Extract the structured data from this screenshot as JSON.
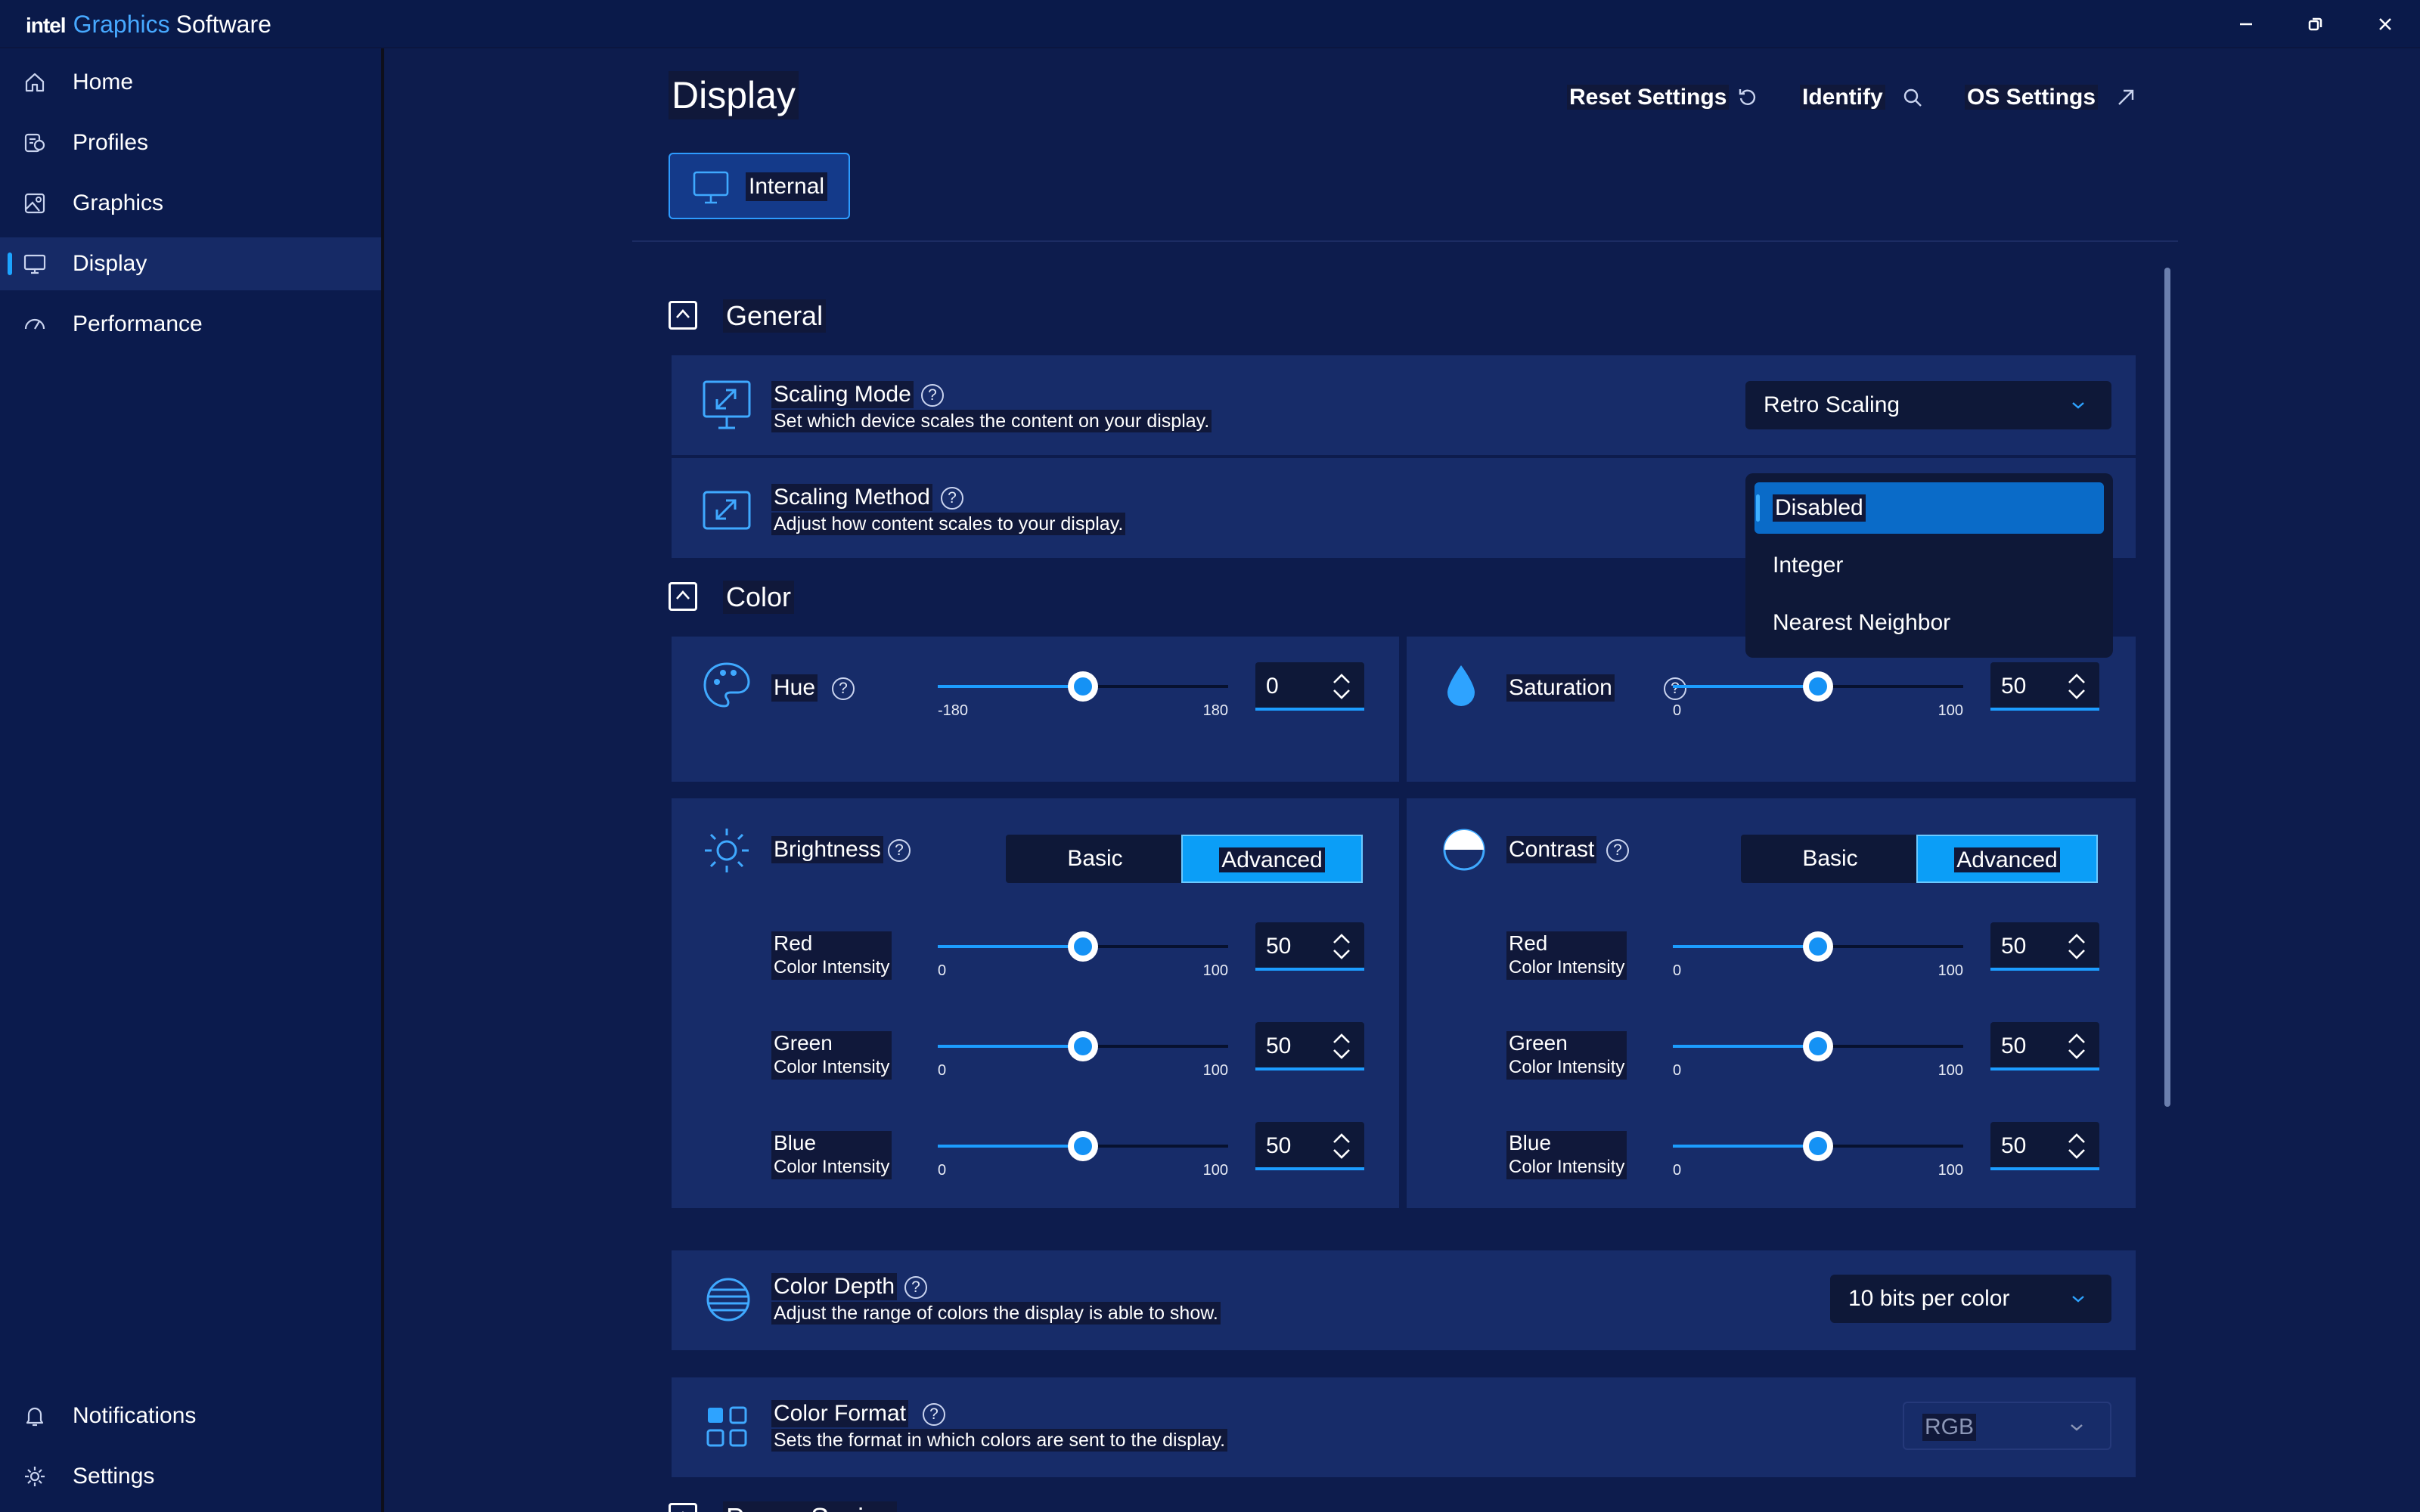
{
  "app": {
    "brand_intel": "intel",
    "brand_graphics": "Graphics",
    "brand_software": "Software",
    "accent_color": "#1c9dff"
  },
  "window_controls": [
    "minimize-icon",
    "restore-icon",
    "close-icon"
  ],
  "sidebar": {
    "items": [
      {
        "label": "Home",
        "icon": "home-icon"
      },
      {
        "label": "Profiles",
        "icon": "profiles-icon"
      },
      {
        "label": "Graphics",
        "icon": "graphics-icon"
      },
      {
        "label": "Display",
        "icon": "display-icon",
        "active": true
      },
      {
        "label": "Performance",
        "icon": "performance-icon"
      }
    ],
    "bottom_items": [
      {
        "label": "Notifications",
        "icon": "bell-icon"
      },
      {
        "label": "Settings",
        "icon": "gear-icon"
      }
    ]
  },
  "header": {
    "title": "Display",
    "reset_label": "Reset Settings",
    "identify_label": "Identify",
    "os_settings_label": "OS Settings",
    "display_tab": "Internal"
  },
  "general": {
    "title": "General",
    "scaling_mode": {
      "title": "Scaling Mode",
      "desc": "Set which device scales the content on your display.",
      "value": "Retro Scaling"
    },
    "scaling_method": {
      "title": "Scaling Method",
      "desc": "Adjust how content scales to your display.",
      "options": [
        "Disabled",
        "Integer",
        "Nearest Neighbor"
      ],
      "selected": "Disabled"
    }
  },
  "color": {
    "title": "Color",
    "hue": {
      "label": "Hue",
      "min": "-180",
      "max": "180",
      "value": "0",
      "min_num": -180,
      "max_num": 180,
      "num": 0
    },
    "saturation": {
      "label": "Saturation",
      "min": "0",
      "max": "100",
      "value": "50",
      "min_num": 0,
      "max_num": 100,
      "num": 50
    },
    "brightness": {
      "label": "Brightness",
      "basic": "Basic",
      "advanced": "Advanced",
      "mode": "Advanced",
      "channels": [
        {
          "name": "Red",
          "sub": "Color Intensity",
          "min": "0",
          "max": "100",
          "value": "50",
          "num": 50
        },
        {
          "name": "Green",
          "sub": "Color Intensity",
          "min": "0",
          "max": "100",
          "value": "50",
          "num": 50
        },
        {
          "name": "Blue",
          "sub": "Color Intensity",
          "min": "0",
          "max": "100",
          "value": "50",
          "num": 50
        }
      ]
    },
    "contrast": {
      "label": "Contrast",
      "basic": "Basic",
      "advanced": "Advanced",
      "mode": "Advanced",
      "channels": [
        {
          "name": "Red",
          "sub": "Color Intensity",
          "min": "0",
          "max": "100",
          "value": "50",
          "num": 50
        },
        {
          "name": "Green",
          "sub": "Color Intensity",
          "min": "0",
          "max": "100",
          "value": "50",
          "num": 50
        },
        {
          "name": "Blue",
          "sub": "Color Intensity",
          "min": "0",
          "max": "100",
          "value": "50",
          "num": 50
        }
      ]
    },
    "depth": {
      "title": "Color Depth",
      "desc": "Adjust the range of colors the display is able to show.",
      "value": "10 bits per color"
    },
    "format": {
      "title": "Color Format",
      "desc": "Sets the format in which colors are sent to the display.",
      "value": "RGB"
    }
  },
  "power_saving": {
    "title": "Power Saving"
  }
}
